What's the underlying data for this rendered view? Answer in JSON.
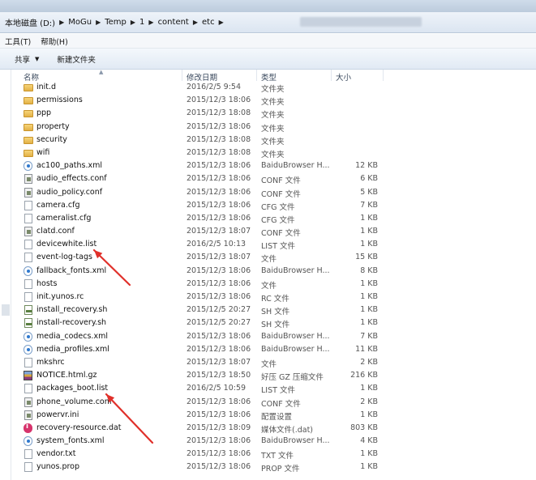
{
  "address": {
    "crumbs": [
      "本地磁盘 (D:)",
      "MoGu",
      "Temp",
      "1",
      "content",
      "etc"
    ]
  },
  "menu": {
    "items": [
      "工具(T)",
      "帮助(H)"
    ]
  },
  "toolbar": {
    "share_label": "共享",
    "new_folder_label": "新建文件夹"
  },
  "columns": {
    "name": "名称",
    "date": "修改日期",
    "type": "类型",
    "size": "大小"
  },
  "files": [
    {
      "name": "init.d",
      "date": "2016/2/5 9:54",
      "type": "文件夹",
      "size": "",
      "icon": "folder-icon"
    },
    {
      "name": "permissions",
      "date": "2015/12/3 18:06",
      "type": "文件夹",
      "size": "",
      "icon": "folder-icon"
    },
    {
      "name": "ppp",
      "date": "2015/12/3 18:08",
      "type": "文件夹",
      "size": "",
      "icon": "folder-icon"
    },
    {
      "name": "property",
      "date": "2015/12/3 18:06",
      "type": "文件夹",
      "size": "",
      "icon": "folder-icon"
    },
    {
      "name": "security",
      "date": "2015/12/3 18:08",
      "type": "文件夹",
      "size": "",
      "icon": "folder-icon"
    },
    {
      "name": "wifi",
      "date": "2015/12/3 18:08",
      "type": "文件夹",
      "size": "",
      "icon": "folder-icon"
    },
    {
      "name": "ac100_paths.xml",
      "date": "2015/12/3 18:06",
      "type": "BaiduBrowser H...",
      "size": "12 KB",
      "icon": "xml-icon"
    },
    {
      "name": "audio_effects.conf",
      "date": "2015/12/3 18:06",
      "type": "CONF 文件",
      "size": "6 KB",
      "icon": "conf-icon"
    },
    {
      "name": "audio_policy.conf",
      "date": "2015/12/3 18:06",
      "type": "CONF 文件",
      "size": "5 KB",
      "icon": "conf-icon"
    },
    {
      "name": "camera.cfg",
      "date": "2015/12/3 18:06",
      "type": "CFG 文件",
      "size": "7 KB",
      "icon": "doc-icon"
    },
    {
      "name": "cameralist.cfg",
      "date": "2015/12/3 18:06",
      "type": "CFG 文件",
      "size": "1 KB",
      "icon": "doc-icon"
    },
    {
      "name": "clatd.conf",
      "date": "2015/12/3 18:07",
      "type": "CONF 文件",
      "size": "1 KB",
      "icon": "conf-icon"
    },
    {
      "name": "devicewhite.list",
      "date": "2016/2/5 10:13",
      "type": "LIST 文件",
      "size": "1 KB",
      "icon": "doc-icon"
    },
    {
      "name": "event-log-tags",
      "date": "2015/12/3 18:07",
      "type": "文件",
      "size": "15 KB",
      "icon": "doc-icon"
    },
    {
      "name": "fallback_fonts.xml",
      "date": "2015/12/3 18:06",
      "type": "BaiduBrowser H...",
      "size": "8 KB",
      "icon": "xml-icon"
    },
    {
      "name": "hosts",
      "date": "2015/12/3 18:06",
      "type": "文件",
      "size": "1 KB",
      "icon": "doc-icon"
    },
    {
      "name": "init.yunos.rc",
      "date": "2015/12/3 18:06",
      "type": "RC 文件",
      "size": "1 KB",
      "icon": "doc-icon"
    },
    {
      "name": "install_recovery.sh",
      "date": "2015/12/5 20:27",
      "type": "SH 文件",
      "size": "1 KB",
      "icon": "sh-icon"
    },
    {
      "name": "install-recovery.sh",
      "date": "2015/12/5 20:27",
      "type": "SH 文件",
      "size": "1 KB",
      "icon": "sh-icon"
    },
    {
      "name": "media_codecs.xml",
      "date": "2015/12/3 18:06",
      "type": "BaiduBrowser H...",
      "size": "7 KB",
      "icon": "xml-icon"
    },
    {
      "name": "media_profiles.xml",
      "date": "2015/12/3 18:06",
      "type": "BaiduBrowser H...",
      "size": "11 KB",
      "icon": "xml-icon"
    },
    {
      "name": "mkshrc",
      "date": "2015/12/3 18:07",
      "type": "文件",
      "size": "2 KB",
      "icon": "doc-icon"
    },
    {
      "name": "NOTICE.html.gz",
      "date": "2015/12/3 18:50",
      "type": "好压 GZ 压缩文件",
      "size": "216 KB",
      "icon": "gz-icon"
    },
    {
      "name": "packages_boot.list",
      "date": "2016/2/5 10:59",
      "type": "LIST 文件",
      "size": "1 KB",
      "icon": "doc-icon"
    },
    {
      "name": "phone_volume.conf",
      "date": "2015/12/3 18:06",
      "type": "CONF 文件",
      "size": "2 KB",
      "icon": "conf-icon"
    },
    {
      "name": "powervr.ini",
      "date": "2015/12/3 18:06",
      "type": "配置设置",
      "size": "1 KB",
      "icon": "conf-icon"
    },
    {
      "name": "recovery-resource.dat",
      "date": "2015/12/3 18:09",
      "type": "媒体文件(.dat)",
      "size": "803 KB",
      "icon": "dat-icon"
    },
    {
      "name": "system_fonts.xml",
      "date": "2015/12/3 18:06",
      "type": "BaiduBrowser H...",
      "size": "4 KB",
      "icon": "xml-icon"
    },
    {
      "name": "vendor.txt",
      "date": "2015/12/3 18:06",
      "type": "TXT 文件",
      "size": "1 KB",
      "icon": "doc-icon"
    },
    {
      "name": "yunos.prop",
      "date": "2015/12/3 18:06",
      "type": "PROP 文件",
      "size": "1 KB",
      "icon": "doc-icon"
    }
  ],
  "annotations": {
    "arrow_color": "#e0302a"
  }
}
